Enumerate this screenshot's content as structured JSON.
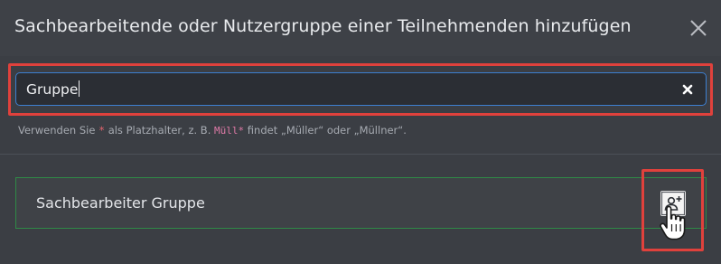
{
  "dialog": {
    "title": "Sachbearbeitende oder Nutzergruppe einer Teilnehmenden hinzufügen",
    "close_icon": "close-icon"
  },
  "search": {
    "value": "Gruppe",
    "clear_icon": "clear-icon",
    "focus_color": "#3d7fd1"
  },
  "hint": {
    "prefix": "Verwenden Sie",
    "wildcard": "*",
    "middle": "als Platzhalter, z. B.",
    "example": "Müll*",
    "suffix": "findet „Müller“ oder „Müllner“."
  },
  "results": [
    {
      "label": "Sachbearbeiter Gruppe",
      "action_icon": "add-user-icon"
    }
  ],
  "colors": {
    "background": "#3b3e44",
    "highlight": "#e0413c",
    "row_border": "#2f8a46"
  }
}
